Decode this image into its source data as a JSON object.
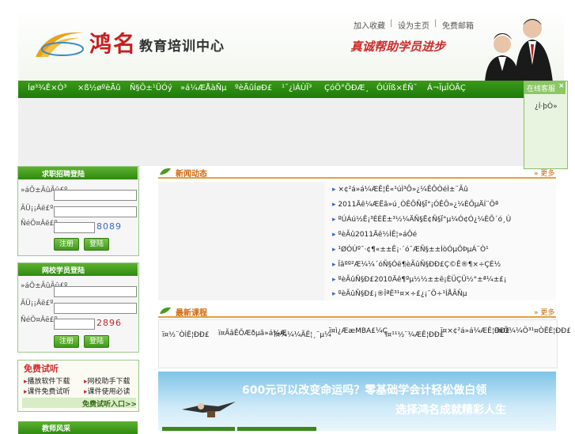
{
  "header": {
    "brand": "鸿名",
    "brand_sub": "教育培训中心",
    "slogan": "真诚帮助学员进步",
    "links": [
      "加入收藏",
      "设为主页",
      "免费邮箱"
    ],
    "separator": "|"
  },
  "nav": {
    "items": [
      "Íø³¾Ê×Ò³",
      "×ß½øºèÃû",
      "Ñ§Ô±¹ÜÓý",
      "»á¼ÆÅàÑµ",
      "ºèÃûÍøÐ£",
      "¹ˉ¿ìÁÙÏ³",
      "ÇóÖ°ÕÐÆ¸",
      "ÔÚÏß×ÉÑ¯",
      "Á¬ÏµÎÒÃÇ"
    ]
  },
  "customer_service": {
    "title": "在线客服",
    "close_icon": "×",
    "text": "¿Í·þÒ»"
  },
  "login_job": {
    "title": "求职招聘登陆",
    "user_label": "»áÔ±ÃûÃû£º",
    "pass_label": "ÃÜ¡¡Âë£º",
    "code_label": "ÑéÖ¤Âë£º",
    "captcha": "8089",
    "register": "注册",
    "login": "登陆"
  },
  "login_school": {
    "title": "网校学员登陆",
    "user_label": "»áÔ±ÃûÃû£º",
    "pass_label": "ÃÜ¡¡Âë£º",
    "code_label": "ÑéÖ¤Âë£º",
    "captcha": "2896",
    "register": "注册",
    "login": "登陆"
  },
  "trial": {
    "title": "免费试听",
    "items": [
      "播放软件下载",
      "网校助手下载",
      "课件免费试听",
      "课件使用必读"
    ],
    "entry": "免费试听入口>>"
  },
  "teacher": {
    "title": "教师风采"
  },
  "news": {
    "title": "新闻动态",
    "more": "» 更多",
    "items": [
      "×¢²á»á¼ÆÊ¦Ê«¹úÌ³Ô»¿¼ÊÔÒéÌ±¨Ãû",
      "2011Äê¼ÆËã»ú¸ÒÊÔÑ§Ï°¡ÓÊÔ»¿¼ÈÕµÄÍ¨Öª",
      "ºÚÁú½­Ê¡³ÉÈË±³½¼ÄÑ§Ë¢Ñ§Ï°µ¼Ó¢Ó¿¼ÈÕ´ó¸Ù",
      "ºèÃû2011Äê½ÌÊ¦»áÔé",
      "¹ØÓÚº¯·¢¶«±±Ê¡·´ó¯ÆÑ§±±ÍòÓµÖÞµÁ¨Ò¹",
      "Îâºº²Æ¼¼´óÑ§Óë¶èÃûÑ§ÐÐ£Ç©Ê®¶×÷ÇÉ½",
      "ºèÃûÑ§Ð£2010Äê¶ºµ½½±±ê¡ÈÜÇÜ½°±ª¼±£¡",
      "ºèÃûÑ§Ð£¡®ÎªÊ³¹¤×÷£¿¡¯Ö÷¹ÌÅÃÑµ"
    ]
  },
  "courses": {
    "title": "最新课程",
    "more": "» 更多",
    "cells": [
      "ï¤½¨ÒÌÊ¦ÐÐ£",
      "ï¤ÃâÊÕÆðµã»á¼Æ",
      "ï¤¾¼¼ÃÊ¦¸¨µ¼",
      "ï¤ì¿ÆæMBA£¼Ç",
      "ï¤¹¹½¨¼ÆÊ¦ÐÐ£",
      "ï¤×¢²á»á¼ÆÊ¦ÐÐ£",
      "ï¤Õ¼¼Ö³¹¤ÒËÈ¦ÐÐ£"
    ]
  },
  "promo": {
    "line1": "600元可以改变命运吗？零基础学会计轻松做白领",
    "line2": "选择鸿名成就精彩人生"
  },
  "colors": {
    "green": "#2f8a10",
    "red": "#c81e1e",
    "orange": "#d06a10"
  }
}
